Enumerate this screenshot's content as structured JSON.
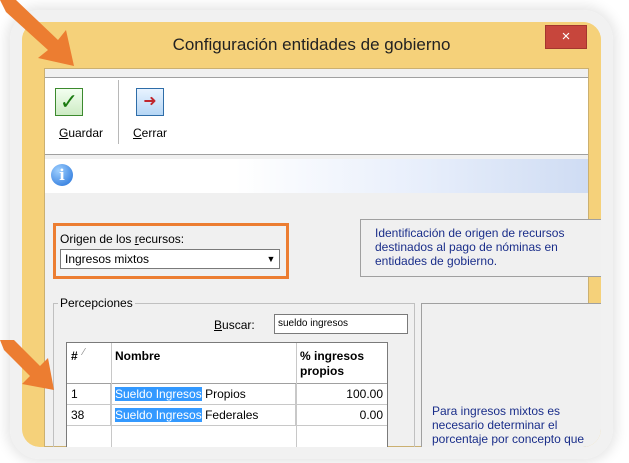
{
  "window": {
    "title": "Configuración entidades de gobierno",
    "close_glyph": "×"
  },
  "toolbar": {
    "save": {
      "label_prefix": "",
      "label_accel": "G",
      "label_rest": "uardar",
      "icon": "check-icon"
    },
    "close": {
      "label_prefix": "",
      "label_accel": "C",
      "label_rest": "errar",
      "icon": "exit-door-icon"
    }
  },
  "info": {
    "icon": "info-icon"
  },
  "origen": {
    "label_prefix": "Origen de los ",
    "label_accel": "r",
    "label_rest": "ecursos:",
    "selected": "Ingresos mixtos",
    "description": "Identificación de origen de recursos destinados al pago de nóminas en entidades de gobierno."
  },
  "percepciones": {
    "legend": "Percepciones",
    "buscar_accel": "B",
    "buscar_rest": "uscar:",
    "search_value": "sueldo ingresos",
    "columns": {
      "num": "#",
      "name": "Nombre",
      "pct": "% ingresos propios"
    },
    "rows": [
      {
        "num": "1",
        "name_match": "Sueldo Ingresos",
        "name_rest": " Propios",
        "pct": "100.00"
      },
      {
        "num": "38",
        "name_match": "Sueldo Ingresos",
        "name_rest": " Federales",
        "pct": "0.00"
      }
    ]
  },
  "side_panel": {
    "text": "Para ingresos mixtos es necesario determinar el porcentaje por concepto que representa el monto de los recursos propios"
  },
  "colors": {
    "title_bar": "#f5d17a",
    "highlight_border": "#ec7d31",
    "selection": "#3399ff",
    "close": "#c7463c"
  }
}
